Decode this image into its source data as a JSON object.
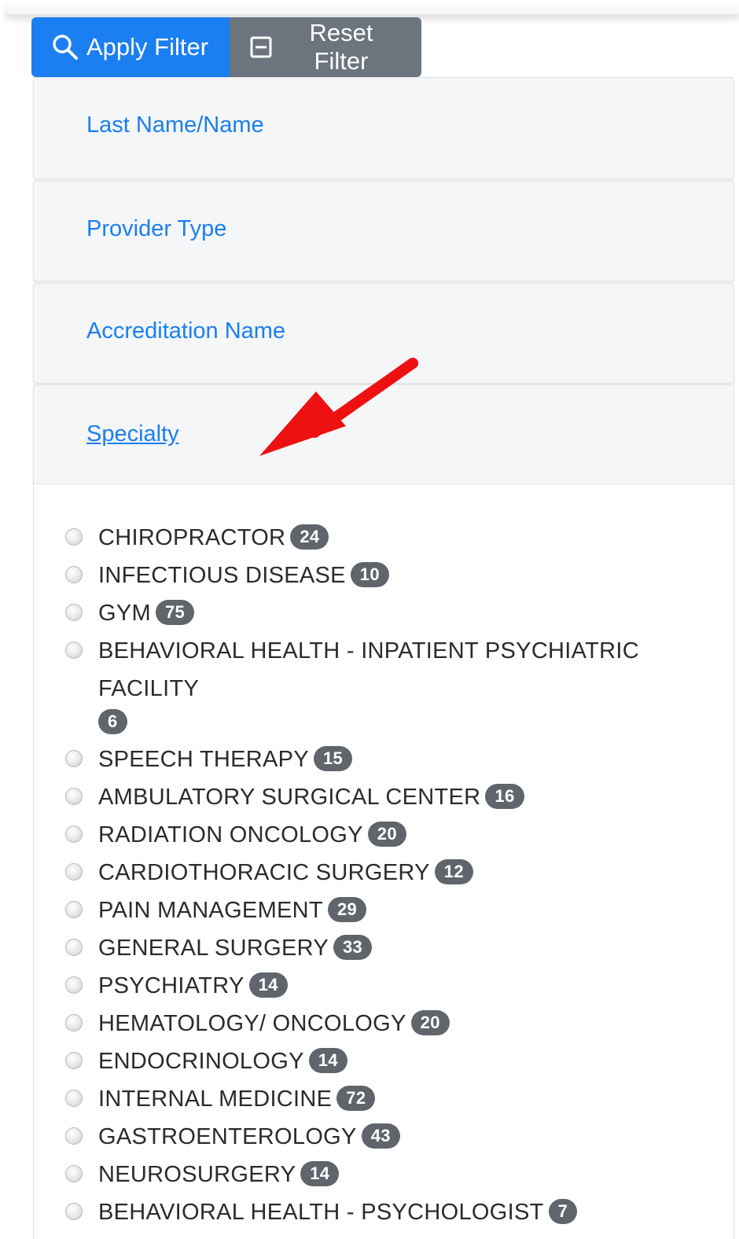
{
  "filters": {
    "apply_label": "Apply Filter",
    "reset_label": "Reset Filter"
  },
  "panels": [
    {
      "title": "Last Name/Name"
    },
    {
      "title": "Provider Type"
    },
    {
      "title": "Accreditation Name"
    },
    {
      "title": "Specialty"
    }
  ],
  "specialties": [
    {
      "name": "CHIROPRACTOR",
      "count": "24"
    },
    {
      "name": "INFECTIOUS DISEASE",
      "count": "10"
    },
    {
      "name": "GYM",
      "count": "75"
    },
    {
      "name": "BEHAVIORAL HEALTH - INPATIENT PSYCHIATRIC FACILITY",
      "count": "6"
    },
    {
      "name": "SPEECH THERAPY",
      "count": "15"
    },
    {
      "name": "AMBULATORY SURGICAL CENTER",
      "count": "16"
    },
    {
      "name": "RADIATION ONCOLOGY",
      "count": "20"
    },
    {
      "name": "CARDIOTHORACIC SURGERY",
      "count": "12"
    },
    {
      "name": "PAIN MANAGEMENT",
      "count": "29"
    },
    {
      "name": "GENERAL SURGERY",
      "count": "33"
    },
    {
      "name": "PSYCHIATRY",
      "count": "14"
    },
    {
      "name": "HEMATOLOGY/ ONCOLOGY",
      "count": "20"
    },
    {
      "name": "ENDOCRINOLOGY",
      "count": "14"
    },
    {
      "name": "INTERNAL MEDICINE",
      "count": "72"
    },
    {
      "name": "GASTROENTEROLOGY",
      "count": "43"
    },
    {
      "name": "NEUROSURGERY",
      "count": "14"
    },
    {
      "name": "BEHAVIORAL HEALTH - PSYCHOLOGIST",
      "count": "7"
    }
  ],
  "colors": {
    "primary": "#1a7ff0",
    "secondary": "#6c757d",
    "badge": "#5f656b",
    "annotation_arrow": "#ee1111"
  },
  "icons": {
    "apply": "search-icon",
    "reset": "minus-square-icon",
    "annotation": "arrow-icon"
  }
}
